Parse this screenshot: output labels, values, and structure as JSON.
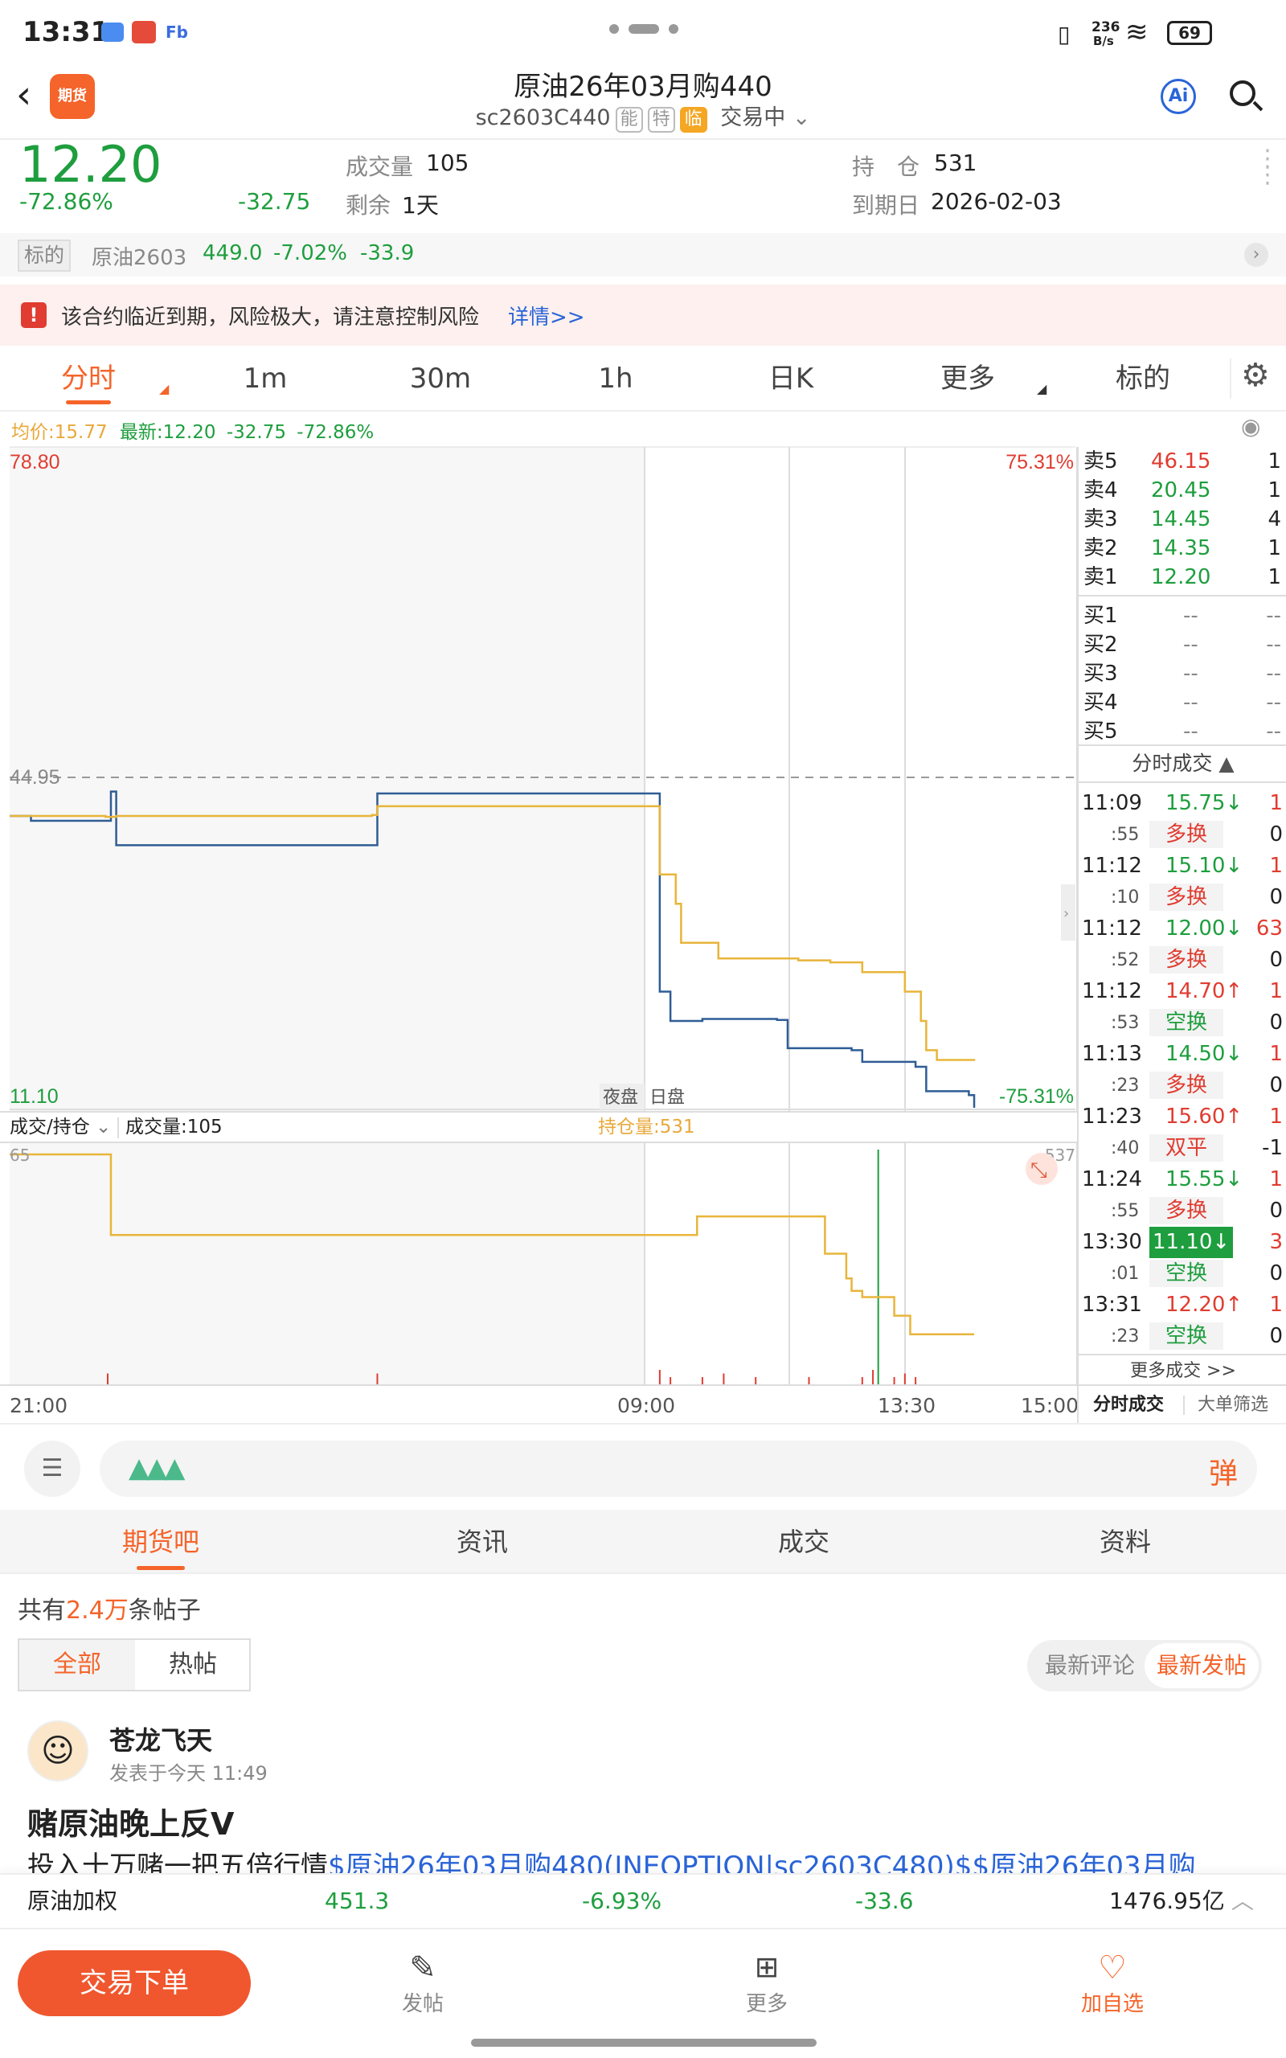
{
  "status_bar": {
    "time": "13:31",
    "net_speed_top": "236",
    "net_speed_bottom": "B/s",
    "battery": "69"
  },
  "header": {
    "title": "原油26年03月购440",
    "code": "sc2603C440",
    "tags": [
      "能",
      "特",
      "临"
    ],
    "trading_status": "交易中",
    "app_badge": "期货",
    "ai_label": "Ai"
  },
  "quote": {
    "price": "12.20",
    "pct": "-72.86%",
    "change": "-32.75",
    "volume_label": "成交量",
    "volume": "105",
    "remain_label": "剩余",
    "remain": "1天",
    "oi_label": "持　仓",
    "oi": "531",
    "expiry_label": "到期日",
    "expiry": "2026-02-03"
  },
  "underlying": {
    "tag": "标的",
    "name": "原油2603",
    "price": "449.0",
    "pct": "-7.02%",
    "change": "-33.9"
  },
  "warning": {
    "text": "该合约临近到期，风险极大，请注意控制风险",
    "link": "详情>>"
  },
  "chart_tabs": [
    "分时",
    "1m",
    "30m",
    "1h",
    "日K",
    "更多",
    "标的"
  ],
  "chart_info": {
    "avg": "均价:15.77",
    "latest": "最新:12.20",
    "change": "-32.75",
    "pct": "-72.86%"
  },
  "axis": {
    "y_top": "78.80",
    "y_bottom": "11.10",
    "pct_top": "75.31%",
    "pct_bottom": "-75.31%",
    "ref_price": "44.95",
    "session_night": "夜盘",
    "session_day": "日盘",
    "times": [
      "21:00",
      "09:00",
      "13:30",
      "15:00"
    ]
  },
  "volume_panel": {
    "selector": "成交/持仓",
    "volume_label": "成交量:105",
    "oi_label": "持仓量:531",
    "left_max": "65",
    "right_max": "537"
  },
  "order_book": {
    "asks": [
      {
        "label": "卖5",
        "price": "46.15",
        "qty": "1"
      },
      {
        "label": "卖4",
        "price": "20.45",
        "qty": "1"
      },
      {
        "label": "卖3",
        "price": "14.45",
        "qty": "4"
      },
      {
        "label": "卖2",
        "price": "14.35",
        "qty": "1"
      },
      {
        "label": "卖1",
        "price": "12.20",
        "qty": "1"
      }
    ],
    "bids": [
      {
        "label": "买1",
        "price": "--",
        "qty": "--"
      },
      {
        "label": "买2",
        "price": "--",
        "qty": "--"
      },
      {
        "label": "买3",
        "price": "--",
        "qty": "--"
      },
      {
        "label": "买4",
        "price": "--",
        "qty": "--"
      },
      {
        "label": "买5",
        "price": "--",
        "qty": "--"
      }
    ]
  },
  "trades_title": "分时成交",
  "trades": [
    {
      "time": "11:09",
      "sec": ":55",
      "price": "15.75↓",
      "dir": "down",
      "vol": "1",
      "type": "多换",
      "oi": "0"
    },
    {
      "time": "11:12",
      "sec": ":10",
      "price": "15.10↓",
      "dir": "down",
      "vol": "1",
      "type": "多换",
      "oi": "0"
    },
    {
      "time": "11:12",
      "sec": ":52",
      "price": "12.00↓",
      "dir": "down",
      "vol": "63",
      "type": "多换",
      "oi": "0"
    },
    {
      "time": "11:12",
      "sec": ":53",
      "price": "14.70↑",
      "dir": "up",
      "vol": "1",
      "type": "空换",
      "oi": "0"
    },
    {
      "time": "11:13",
      "sec": ":23",
      "price": "14.50↓",
      "dir": "down",
      "vol": "1",
      "type": "多换",
      "oi": "0"
    },
    {
      "time": "11:23",
      "sec": ":40",
      "price": "15.60↑",
      "dir": "up",
      "vol": "1",
      "type": "双平",
      "oi": "-1"
    },
    {
      "time": "11:24",
      "sec": ":55",
      "price": "15.55↓",
      "dir": "down",
      "vol": "1",
      "type": "多换",
      "oi": "0"
    },
    {
      "time": "13:30",
      "sec": ":01",
      "price": "11.10↓",
      "dir": "highlight",
      "vol": "3",
      "type": "空换",
      "oi": "0"
    },
    {
      "time": "13:31",
      "sec": ":23",
      "price": "12.20↑",
      "dir": "up",
      "vol": "1",
      "type": "空换",
      "oi": "0"
    }
  ],
  "more_trades": "更多成交 >>",
  "side_tabs": [
    "分时成交",
    "大单筛选"
  ],
  "comment_bar": {
    "danmu": "弹"
  },
  "section_tabs": [
    "期货吧",
    "资讯",
    "成交",
    "资料"
  ],
  "forum": {
    "count_prefix": "共有",
    "count": "2.4万",
    "count_suffix": "条帖子",
    "filters": [
      "全部",
      "热帖"
    ],
    "sort": [
      "最新评论",
      "最新发帖"
    ]
  },
  "post": {
    "author": "苍龙飞天",
    "time": "发表于今天 11:49",
    "title": "赌原油晚上反V",
    "body_prefix": "投入十万赌一把五倍行情",
    "body_link": "$原油26年03月购480(INEOPTION|sc2603C480)$$原油26年03月购"
  },
  "ticker": {
    "name": "原油加权",
    "price": "451.3",
    "pct": "-6.93%",
    "change": "-33.6",
    "amount": "1476.95亿"
  },
  "bottom_nav": {
    "trade_button": "交易下单",
    "items": [
      "发帖",
      "更多",
      "加自选"
    ]
  },
  "chart_data": {
    "type": "line",
    "title": "",
    "x_ticks": [
      "21:00",
      "09:00",
      "13:30",
      "15:00"
    ],
    "ylim": [
      11.1,
      78.8
    ],
    "reference": 44.95,
    "series": [
      {
        "name": "",
        "color": "#2f5d95",
        "values": [
          [
            0.0,
            41.0
          ],
          [
            0.02,
            40.5
          ],
          [
            0.09,
            40.5
          ],
          [
            0.095,
            43.5
          ],
          [
            0.1,
            38.0
          ],
          [
            0.34,
            38.0
          ],
          [
            0.345,
            43.3
          ],
          [
            0.6,
            43.3
          ],
          [
            0.61,
            23.0
          ],
          [
            0.62,
            20.0
          ],
          [
            0.65,
            20.2
          ],
          [
            0.72,
            20.1
          ],
          [
            0.73,
            17.2
          ],
          [
            0.79,
            17.0
          ],
          [
            0.8,
            15.8
          ],
          [
            0.85,
            15.3
          ],
          [
            0.86,
            12.8
          ],
          [
            0.9,
            12.4
          ],
          [
            0.905,
            11.1
          ]
        ]
      },
      {
        "name": "",
        "color": "#e8b53a",
        "values": [
          [
            0.0,
            41.0
          ],
          [
            0.09,
            40.9
          ],
          [
            0.1,
            41.0
          ],
          [
            0.34,
            41.1
          ],
          [
            0.345,
            42.0
          ],
          [
            0.6,
            42.0
          ],
          [
            0.61,
            35.0
          ],
          [
            0.625,
            32.0
          ],
          [
            0.63,
            28.0
          ],
          [
            0.665,
            26.4
          ],
          [
            0.74,
            26.2
          ],
          [
            0.77,
            26.0
          ],
          [
            0.8,
            25.0
          ],
          [
            0.84,
            23.0
          ],
          [
            0.855,
            20.0
          ],
          [
            0.86,
            17.0
          ],
          [
            0.87,
            16.0
          ],
          [
            0.905,
            15.9
          ]
        ]
      }
    ],
    "open_interest": [
      [
        0.0,
        65
      ],
      [
        0.09,
        65
      ],
      [
        0.095,
        52
      ],
      [
        0.64,
        52
      ],
      [
        0.645,
        55
      ],
      [
        0.76,
        55
      ],
      [
        0.765,
        49
      ],
      [
        0.785,
        45
      ],
      [
        0.79,
        43
      ],
      [
        0.8,
        42
      ],
      [
        0.81,
        42
      ],
      [
        0.83,
        39
      ],
      [
        0.84,
        39
      ],
      [
        0.845,
        36
      ],
      [
        0.905,
        36
      ]
    ],
    "volume_bars": [
      [
        0.092,
        3
      ],
      [
        0.345,
        3
      ],
      [
        0.61,
        4
      ],
      [
        0.62,
        2
      ],
      [
        0.65,
        2
      ],
      [
        0.67,
        3
      ],
      [
        0.7,
        2
      ],
      [
        0.75,
        2
      ],
      [
        0.8,
        2
      ],
      [
        0.81,
        4
      ],
      [
        0.815,
        65
      ],
      [
        0.83,
        2
      ],
      [
        0.84,
        3
      ],
      [
        0.85,
        2
      ]
    ]
  }
}
